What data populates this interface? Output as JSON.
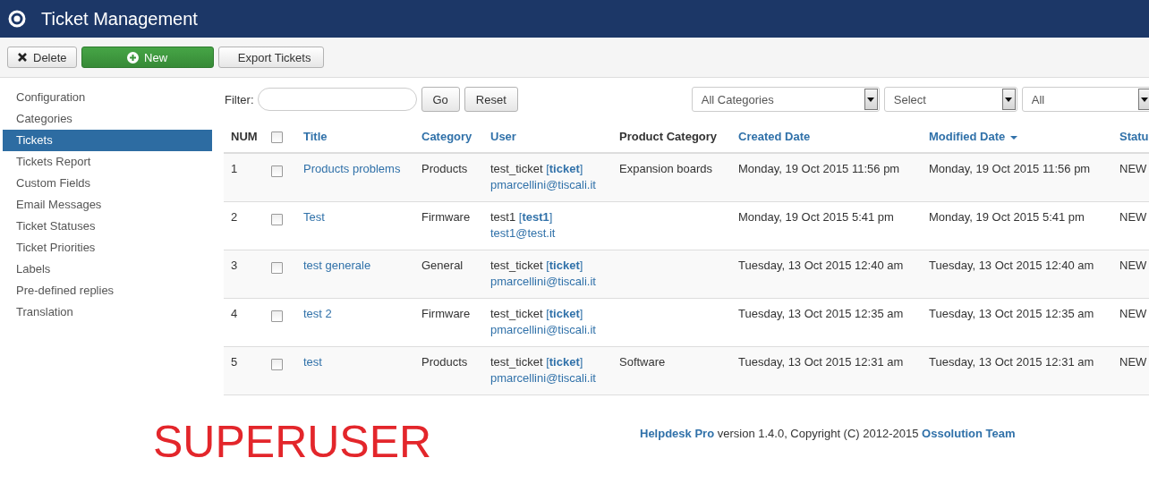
{
  "window": {
    "title": "Ticket Management"
  },
  "toolbar": [
    {
      "label": "Delete",
      "kind": "delete"
    },
    {
      "label": "New",
      "kind": "new"
    },
    {
      "label": "Export Tickets",
      "kind": "plain"
    }
  ],
  "sidebar": {
    "items": [
      {
        "label": "Configuration",
        "selected": false
      },
      {
        "label": "Categories",
        "selected": false
      },
      {
        "label": "Tickets",
        "selected": true
      },
      {
        "label": "Tickets Report",
        "selected": false
      },
      {
        "label": "Custom Fields",
        "selected": false
      },
      {
        "label": "Email Messages",
        "selected": false
      },
      {
        "label": "Ticket Statuses",
        "selected": false
      },
      {
        "label": "Ticket Priorities",
        "selected": false
      },
      {
        "label": "Labels",
        "selected": false
      },
      {
        "label": "Pre-defined replies",
        "selected": false
      },
      {
        "label": "Translation",
        "selected": false
      }
    ]
  },
  "filter": {
    "label": "Filter:",
    "go": "Go",
    "reset": "Reset",
    "dropdowns": [
      "All Categories",
      "Select",
      "All"
    ]
  },
  "table": {
    "all_checked": false,
    "columns": [
      {
        "label": "NUM",
        "kind": "plain",
        "sorted": false
      },
      {
        "kind": "checkbox",
        "sorted": false
      },
      {
        "label": "Title",
        "kind": "link",
        "sorted": false
      },
      {
        "label": "Category",
        "kind": "link",
        "sorted": false
      },
      {
        "label": "User",
        "kind": "link",
        "sorted": false
      },
      {
        "label": "Product Category",
        "kind": "plain",
        "sorted": false
      },
      {
        "label": "Created Date",
        "kind": "link",
        "sorted": false
      },
      {
        "label": "Modified Date",
        "kind": "link",
        "sorted": true
      },
      {
        "label": "Statu",
        "kind": "link",
        "sorted": false
      }
    ],
    "rows": [
      {
        "num": "1",
        "checked": false,
        "title": "Products problems",
        "category": "Products",
        "user": "test_ticket",
        "username": "[**ticket**]",
        "email": "pmarcellini@tiscali.it",
        "product_category": "Expansion boards",
        "created": "Monday, 19 Oct 2015 11:56 pm",
        "modified": "Monday, 19 Oct 2015 11:56 pm",
        "status": "NEW"
      },
      {
        "num": "2",
        "checked": false,
        "title": "Test",
        "category": "Firmware",
        "user": "test1",
        "username": "[**test1**]",
        "email": "test1@test.it",
        "created": "Monday, 19 Oct 2015 5:41 pm",
        "modified": "Monday, 19 Oct 2015 5:41 pm",
        "status": "NEW"
      },
      {
        "num": "3",
        "checked": false,
        "title": "test generale",
        "category": "General",
        "user": "test_ticket",
        "username": "[**ticket**]",
        "email": "pmarcellini@tiscali.it",
        "created": "Tuesday, 13 Oct 2015 12:40 am",
        "modified": "Tuesday, 13 Oct 2015 12:40 am",
        "status": "NEW"
      },
      {
        "num": "4",
        "checked": false,
        "title": "test 2",
        "category": "Firmware",
        "user": "test_ticket",
        "username": "[**ticket**]",
        "email": "pmarcellini@tiscali.it",
        "created": "Tuesday, 13 Oct 2015 12:35 am",
        "modified": "Tuesday, 13 Oct 2015 12:35 am",
        "status": "NEW"
      },
      {
        "num": "5",
        "checked": false,
        "title": "test",
        "category": "Products",
        "user": "test_ticket",
        "username": "[**ticket**]",
        "email": "pmarcellini@tiscali.it",
        "product_category": "Software",
        "created": "Tuesday, 13 Oct 2015 12:31 am",
        "modified": "Tuesday, 13 Oct 2015 12:31 am",
        "status": "NEW"
      }
    ]
  },
  "annotation": "SUPERUSER",
  "footer": {
    "product": "Helpdesk Pro",
    "text": " version 1.4.0, Copyright (C) 2012-2015 ",
    "team": "Ossolution Team"
  }
}
